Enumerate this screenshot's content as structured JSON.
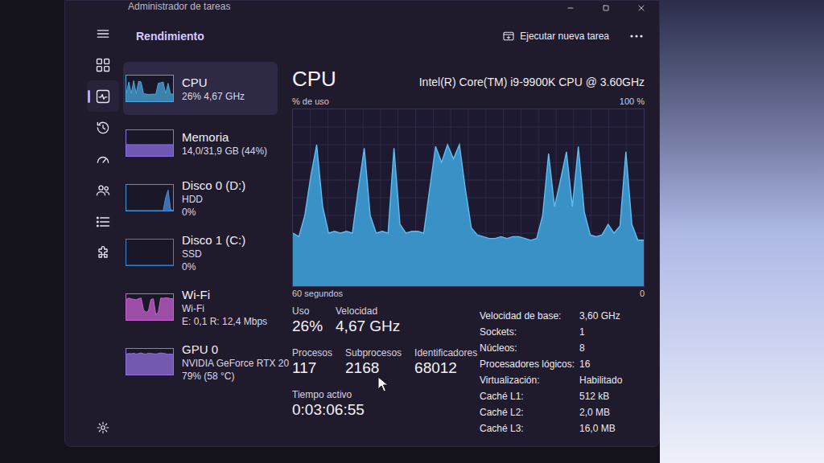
{
  "window": {
    "title": "Administrador de tareas"
  },
  "nav": {
    "items": [
      {
        "kind": "processes",
        "selected": false
      },
      {
        "kind": "performance",
        "selected": true
      },
      {
        "kind": "history",
        "selected": false
      },
      {
        "kind": "startup",
        "selected": false
      },
      {
        "kind": "users",
        "selected": false
      },
      {
        "kind": "details",
        "selected": false
      },
      {
        "kind": "services",
        "selected": false
      }
    ]
  },
  "header": {
    "title": "Rendimiento",
    "run_task": "Ejecutar nueva tarea"
  },
  "resources": [
    {
      "name": "CPU",
      "lines": [
        "26% 4,67 GHz"
      ],
      "selected": true,
      "color": "#4aa6dc",
      "graph": [
        30,
        75,
        30,
        80,
        30,
        78,
        75,
        30,
        28,
        27,
        27,
        28,
        27,
        70,
        72,
        75,
        30,
        70,
        28,
        28
      ]
    },
    {
      "name": "Memoria",
      "lines": [
        "14,0/31,9 GB (44%)"
      ],
      "selected": false,
      "color": "#8c6fe3",
      "graph": [
        44,
        44,
        44,
        44,
        44,
        44,
        44,
        44,
        44,
        44,
        44,
        44,
        44,
        44,
        44,
        44,
        44,
        44,
        44,
        44
      ]
    },
    {
      "name": "Disco 0 (D:)",
      "lines": [
        "HDD",
        "0%"
      ],
      "selected": false,
      "color": "#4a8fd9",
      "graph": [
        0,
        0,
        0,
        0,
        0,
        0,
        0,
        0,
        0,
        0,
        0,
        0,
        0,
        0,
        0,
        0,
        50,
        80,
        5,
        0
      ]
    },
    {
      "name": "Disco 1 (C:)",
      "lines": [
        "SSD",
        "0%"
      ],
      "selected": false,
      "color": "#3f7fc4",
      "graph": [
        0,
        0,
        0,
        0,
        0,
        0,
        0,
        0,
        0,
        0,
        0,
        0,
        0,
        0,
        0,
        0,
        0,
        0,
        0,
        0
      ]
    },
    {
      "name": "Wi-Fi",
      "lines": [
        "Wi-Fi",
        "E: 0,1 R: 12,4 Mbps"
      ],
      "selected": false,
      "color": "#c862d2",
      "graph": [
        80,
        85,
        82,
        80,
        78,
        83,
        85,
        40,
        30,
        35,
        80,
        82,
        20,
        30,
        85,
        84,
        86,
        85,
        83,
        82
      ]
    },
    {
      "name": "GPU 0",
      "lines": [
        "NVIDIA GeForce RTX 20",
        "79% (58 °C)"
      ],
      "selected": false,
      "color": "#9272dc",
      "graph": [
        80,
        82,
        81,
        83,
        80,
        82,
        84,
        81,
        80,
        83,
        82,
        81,
        80,
        82,
        84,
        83,
        81,
        79,
        80,
        79
      ]
    }
  ],
  "cpu": {
    "title": "CPU",
    "model": "Intel(R) Core(TM) i9-9900K CPU @ 3.60GHz",
    "axis_label": "% de uso",
    "axis_max": "100 %",
    "time_label": "60 segundos",
    "axis_min": "0",
    "series": [
      30,
      28,
      40,
      62,
      80,
      45,
      30,
      31,
      30,
      31,
      30,
      55,
      78,
      40,
      30,
      31,
      30,
      78,
      35,
      30,
      31,
      31,
      30,
      55,
      79,
      70,
      80,
      72,
      80,
      55,
      33,
      29,
      28,
      27,
      27,
      28,
      27,
      28,
      28,
      27,
      26,
      27,
      40,
      75,
      45,
      60,
      76,
      45,
      79,
      42,
      29,
      28,
      29,
      35,
      30,
      34,
      76,
      35,
      26,
      26
    ],
    "stat_rows": [
      [
        {
          "label": "Uso",
          "value": "26%"
        },
        {
          "label": "Velocidad",
          "value": "4,67 GHz"
        }
      ],
      [
        {
          "label": "Procesos",
          "value": "117"
        },
        {
          "label": "Subprocesos",
          "value": "2168"
        },
        {
          "label": "Identificadores",
          "value": "68012"
        }
      ],
      [
        {
          "label": "Tiempo activo",
          "value": "0:03:06:55"
        }
      ]
    ],
    "details": [
      {
        "label": "Velocidad de base:",
        "value": "3,60 GHz"
      },
      {
        "label": "Sockets:",
        "value": "1"
      },
      {
        "label": "Núcleos:",
        "value": "8"
      },
      {
        "label": "Procesadores lógicos:",
        "value": "16"
      },
      {
        "label": "Virtualización:",
        "value": "Habilitado"
      },
      {
        "label": "Caché L1:",
        "value": "512 kB"
      },
      {
        "label": "Caché L2:",
        "value": "2,0 MB"
      },
      {
        "label": "Caché L3:",
        "value": "16,0 MB"
      }
    ]
  }
}
